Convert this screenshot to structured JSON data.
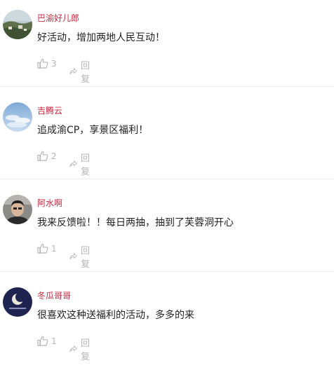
{
  "comments": [
    {
      "username": "巴渝好儿郎",
      "text": "好活动，增加两地人民互动！",
      "likes": "3",
      "reply_label": "回复",
      "avatar_icon": "landscape-avatar"
    },
    {
      "username": "吉腾云",
      "text": "追成渝CP，享景区福利！",
      "likes": "2",
      "reply_label": "回复",
      "avatar_icon": "sky-avatar"
    },
    {
      "username": "阿水啊",
      "text": "我来反馈啦！！每日两抽，抽到了芙蓉洞开心",
      "likes": "1",
      "reply_label": "回复",
      "avatar_icon": "person-avatar"
    },
    {
      "username": "冬瓜哥哥",
      "text": "很喜欢这种送福利的活动，多多的来",
      "likes": "1",
      "reply_label": "回复",
      "avatar_icon": "moon-avatar"
    }
  ],
  "colors": {
    "username": "#c8283e",
    "text": "#222222",
    "meta": "#b4b4b4",
    "divider": "#ececec"
  }
}
